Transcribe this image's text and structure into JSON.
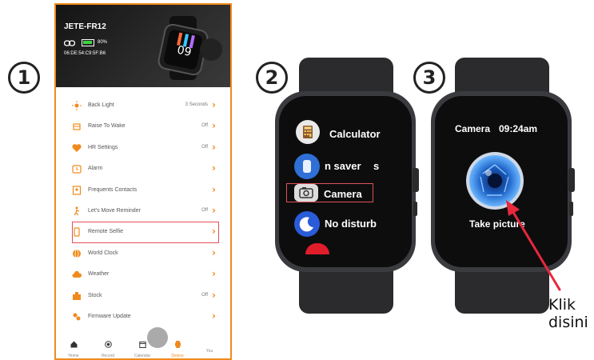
{
  "steps": {
    "one": "1",
    "two": "2",
    "three": "3"
  },
  "phone": {
    "device_name": "JETE-FR12",
    "battery_percent": "80%",
    "battery_level": 0.8,
    "mac_address": "06:DE:54:C9:5F:B6",
    "menu": [
      {
        "label": "Back Light",
        "value": "3 Seconds",
        "icon": "sun-icon"
      },
      {
        "label": "Raise To Wake",
        "value": "Off",
        "icon": "raise-hand-icon"
      },
      {
        "label": "HR Settings",
        "value": "Off",
        "icon": "heart-icon"
      },
      {
        "label": "Alarm",
        "value": "",
        "icon": "alarm-clock-icon"
      },
      {
        "label": "Frequents Contacts",
        "value": "",
        "icon": "contacts-icon"
      },
      {
        "label": "Let's Move Reminder",
        "value": "Off",
        "icon": "walking-icon"
      },
      {
        "label": "Remote Selfie",
        "value": "",
        "icon": "phone-camera-icon"
      },
      {
        "label": "World Clock",
        "value": "",
        "icon": "globe-icon"
      },
      {
        "label": "Weather",
        "value": "",
        "icon": "cloud-icon"
      },
      {
        "label": "Stock",
        "value": "Off",
        "icon": "stock-icon"
      },
      {
        "label": "Firmware Update",
        "value": "",
        "icon": "firmware-icon"
      }
    ],
    "tabs": [
      "Home",
      "Record",
      "Calendar",
      "Device",
      "You"
    ],
    "active_tab": "Device",
    "accent_color": "#f08a1c",
    "highlight_color": "#e0505a"
  },
  "watch2": {
    "items": [
      "Calculator",
      "n saver",
      "s",
      "Camera",
      "No disturb"
    ]
  },
  "watch3": {
    "app_title": "Camera",
    "time": "09:24am",
    "action_label": "Take picture"
  },
  "annotation": {
    "line1": "Klik",
    "line2": "disini",
    "color": "#e8283c"
  }
}
